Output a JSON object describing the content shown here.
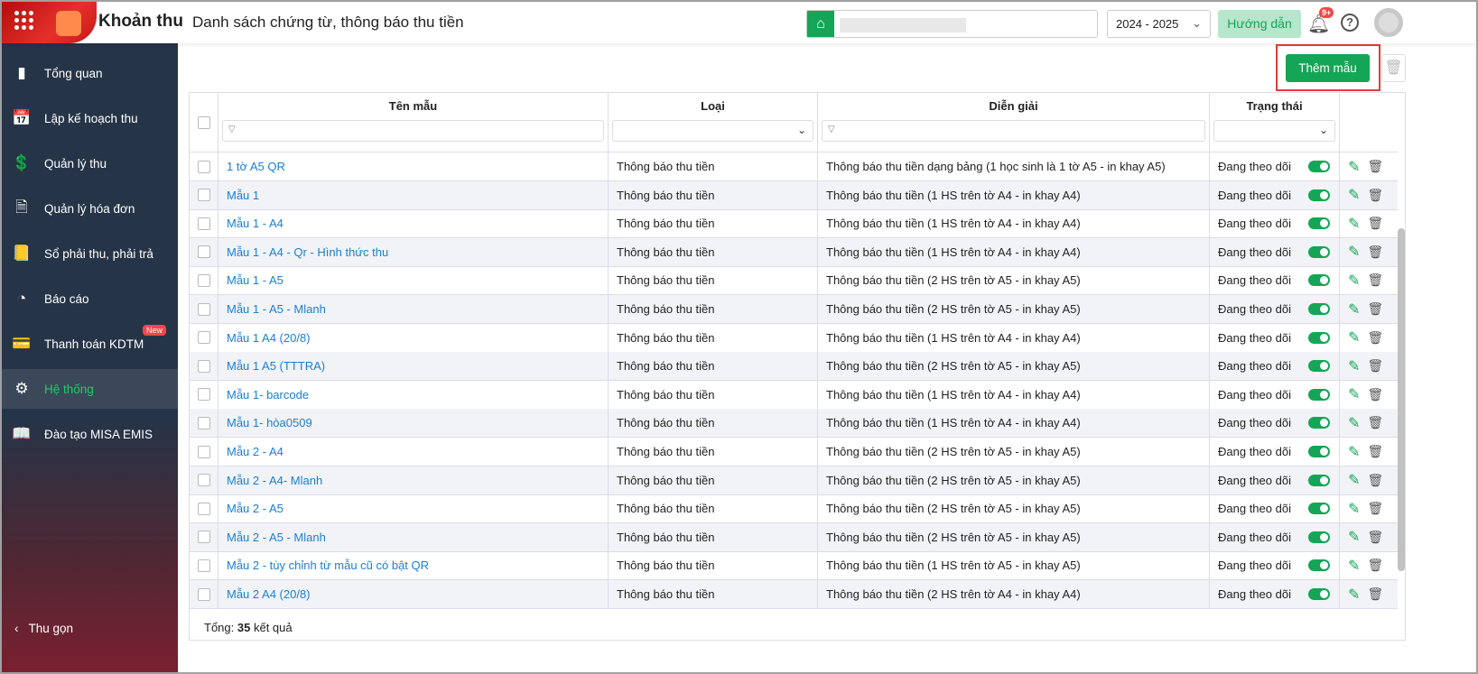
{
  "header": {
    "app_title": "Khoản thu",
    "page_title": "Danh sách chứng từ, thông báo thu tiền",
    "year": "2024 - 2025",
    "guide": "Hướng dẫn",
    "notif_badge": "9+",
    "help": "?"
  },
  "sidebar": {
    "items": [
      {
        "label": "Tổng quan",
        "icon": "bar-chart-icon",
        "glyph": "▮"
      },
      {
        "label": "Lập kế hoạch thu",
        "icon": "calendar-money-icon",
        "glyph": "📅"
      },
      {
        "label": "Quản lý thu",
        "icon": "money-hand-icon",
        "glyph": "💲"
      },
      {
        "label": "Quản lý hóa đơn",
        "icon": "invoice-icon",
        "glyph": "🗎"
      },
      {
        "label": "Sổ phải thu, phải trả",
        "icon": "ledger-icon",
        "glyph": "📒"
      },
      {
        "label": "Báo cáo",
        "icon": "pie-chart-icon",
        "glyph": "◔"
      },
      {
        "label": "Thanh toán KDTM",
        "icon": "card-icon",
        "glyph": "💳",
        "badge": "New"
      },
      {
        "label": "Hệ thống",
        "icon": "gear-icon",
        "glyph": "⚙",
        "active": true
      },
      {
        "label": "Đào tạo MISA EMIS",
        "icon": "book-icon",
        "glyph": "📖"
      }
    ],
    "collapse": "Thu gọn"
  },
  "toolbar": {
    "add": "Thêm mẫu"
  },
  "table": {
    "columns": [
      "Tên mẫu",
      "Loại",
      "Diễn giải",
      "Trạng thái"
    ],
    "rows": [
      {
        "name": "1 tờ A5 QR",
        "type": "Thông báo thu tiền",
        "desc": "Thông báo thu tiền dạng bảng (1 học sinh là 1 tờ A5 - in khay A5)",
        "status": "Đang theo dõi"
      },
      {
        "name": "Mẫu 1",
        "type": "Thông báo thu tiền",
        "desc": "Thông báo thu tiền (1 HS trên tờ A4 - in khay A4)",
        "status": "Đang theo dõi"
      },
      {
        "name": "Mẫu 1 - A4",
        "type": "Thông báo thu tiền",
        "desc": "Thông báo thu tiền (1 HS trên tờ A4 - in khay A4)",
        "status": "Đang theo dõi"
      },
      {
        "name": "Mẫu 1 - A4 - Qr - Hình thức thu",
        "type": "Thông báo thu tiền",
        "desc": "Thông báo thu tiền (1 HS trên tờ A4 - in khay A4)",
        "status": "Đang theo dõi"
      },
      {
        "name": "Mẫu 1 - A5",
        "type": "Thông báo thu tiền",
        "desc": "Thông báo thu tiền (2 HS trên tờ A5 - in khay A5)",
        "status": "Đang theo dõi"
      },
      {
        "name": "Mẫu 1 - A5 - Mlanh",
        "type": "Thông báo thu tiền",
        "desc": "Thông báo thu tiền (2 HS trên tờ A5 - in khay A5)",
        "status": "Đang theo dõi"
      },
      {
        "name": "Mẫu 1 A4 (20/8)",
        "type": "Thông báo thu tiền",
        "desc": "Thông báo thu tiền (1 HS trên tờ A4 - in khay A4)",
        "status": "Đang theo dõi"
      },
      {
        "name": "Mẫu 1 A5 (TTTRA)",
        "type": "Thông báo thu tiền",
        "desc": "Thông báo thu tiền (2 HS trên tờ A5 - in khay A5)",
        "status": "Đang theo dõi"
      },
      {
        "name": "Mẫu 1- barcode",
        "type": "Thông báo thu tiền",
        "desc": "Thông báo thu tiền (1 HS trên tờ A4 - in khay A4)",
        "status": "Đang theo dõi"
      },
      {
        "name": "Mẫu 1- hòa0509",
        "type": "Thông báo thu tiền",
        "desc": "Thông báo thu tiền (1 HS trên tờ A4 - in khay A4)",
        "status": "Đang theo dõi"
      },
      {
        "name": "Mẫu 2 - A4",
        "type": "Thông báo thu tiền",
        "desc": "Thông báo thu tiền (2 HS trên tờ A5 - in khay A5)",
        "status": "Đang theo dõi"
      },
      {
        "name": "Mẫu 2 - A4- Mlanh",
        "type": "Thông báo thu tiền",
        "desc": "Thông báo thu tiền (2 HS trên tờ A5 - in khay A5)",
        "status": "Đang theo dõi"
      },
      {
        "name": "Mẫu 2 - A5",
        "type": "Thông báo thu tiền",
        "desc": "Thông báo thu tiền (2 HS trên tờ A5 - in khay A5)",
        "status": "Đang theo dõi"
      },
      {
        "name": "Mẫu 2 - A5 - Mlanh",
        "type": "Thông báo thu tiền",
        "desc": "Thông báo thu tiền (2 HS trên tờ A5 - in khay A5)",
        "status": "Đang theo dõi"
      },
      {
        "name": "Mẫu 2 - tùy chỉnh từ mẫu cũ có bật QR",
        "type": "Thông báo thu tiền",
        "desc": "Thông báo thu tiền (1 HS trên tờ A5 - in khay A5)",
        "status": "Đang theo dõi"
      },
      {
        "name": "Mẫu 2 A4 (20/8)",
        "type": "Thông báo thu tiền",
        "desc": "Thông báo thu tiền (2 HS trên tờ A4 - in khay A4)",
        "status": "Đang theo dõi"
      }
    ]
  },
  "footer": {
    "label": "Tổng:",
    "count": "35",
    "suffix": "kết quả"
  },
  "colors": {
    "accent": "#14a556",
    "link": "#1a7fd4",
    "sidebar": "#263447",
    "highlight": "#e83a3a"
  }
}
